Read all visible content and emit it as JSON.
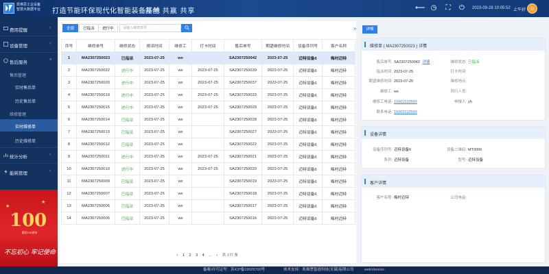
{
  "header": {
    "brand_line1": "凯维思工业设备",
    "brand_line2": "智慧大数据平台",
    "title": "打造节能环保现代化智能装备基地",
    "slogan": "共创 共赢 共享",
    "datetime": "2023-09-28 10:05:52",
    "ampm": "上午好",
    "icons": [
      "back-arrow-icon",
      "clock-icon",
      "fullscreen-icon",
      "power-icon",
      "avatar"
    ]
  },
  "sidebar": {
    "groups": [
      {
        "label": "费用提醒",
        "icon": "money-icon"
      },
      {
        "label": "设备管理",
        "icon": "device-icon"
      },
      {
        "label": "售后服务",
        "icon": "service-icon"
      }
    ],
    "after_sales_title": "售后管理",
    "after_sales_items": [
      "实时售后单",
      "历史售后单"
    ],
    "repair_title": "维修管理",
    "repair_items": [
      "实时维修单",
      "历史维修单"
    ],
    "other_groups": [
      {
        "label": "统计分析",
        "icon": "chart-icon"
      },
      {
        "label": "能耗管理",
        "icon": "energy-icon"
      }
    ],
    "banner_number": "100",
    "banner_sub": "建党100周年",
    "banner_calligraphy": "不忘初心 牢记使命"
  },
  "filter": {
    "tabs": [
      "全部",
      "已指派",
      "进行中"
    ],
    "active_tab": "全部",
    "search_placeholder": "请输入维修单号"
  },
  "table": {
    "headers": [
      "序号",
      "维修单号",
      "维修状态",
      "报派时间",
      "维修工",
      "打卡时间",
      "售后单号",
      "期望维修时间",
      "设备序列号",
      "客户名称"
    ],
    "rows": [
      [
        "1",
        "MA2307250023",
        "已指派",
        "2023-07-25",
        "wx",
        "",
        "SA2307250042",
        "2023-07-25",
        "迈特设备6",
        "梅村迈特"
      ],
      [
        "2",
        "MA2307250022",
        "进行中",
        "2023-07-25",
        "wx",
        "2023-07-25",
        "SA2307250039",
        "2023-07-25",
        "迈特设备6",
        "梅村迈特"
      ],
      [
        "3",
        "MA2307250020",
        "进行中",
        "2023-07-25",
        "wx",
        "2023-07-25",
        "SA2307250037",
        "2023-07-25",
        "迈特设备6",
        "梅村迈特"
      ],
      [
        "4",
        "MA2307250019",
        "进行中",
        "2023-07-25",
        "wx",
        "2023-07-25",
        "SA2307250033",
        "2023-07-25",
        "迈特设备6",
        "梅村迈特"
      ],
      [
        "5",
        "MA2307250015",
        "进行中",
        "2023-07-25",
        "wx",
        "2023-07-25",
        "SA2307250029",
        "2023-07-25",
        "迈特设备6",
        "梅村迈特"
      ],
      [
        "6",
        "MA2307250014",
        "已指派",
        "2023-07-25",
        "wx",
        "",
        "SA2307250028",
        "2023-07-25",
        "迈特设备6",
        "梅村迈特"
      ],
      [
        "7",
        "MA2307250013",
        "已指派",
        "2023-07-25",
        "wx",
        "",
        "SA2307250027",
        "2023-07-25",
        "迈特设备6",
        "梅村迈特"
      ],
      [
        "8",
        "MA2307250012",
        "已指派",
        "2023-07-25",
        "wx",
        "",
        "SA2307250022",
        "2023-07-25",
        "迈特设备6",
        "梅村迈特"
      ],
      [
        "9",
        "MA2307250011",
        "进行中",
        "2023-07-25",
        "wx",
        "2023-07-25",
        "SA2307250021",
        "2023-07-25",
        "迈特设备6",
        "梅村迈特"
      ],
      [
        "10",
        "MA2307250010",
        "进行中",
        "2023-07-25",
        "wx",
        "2023-07-25",
        "SA2307250020",
        "2023-07-25",
        "迈特设备6",
        "梅村迈特"
      ],
      [
        "11",
        "MA2307250009",
        "已指派",
        "2023-07-25",
        "wx",
        "",
        "SA2307250019",
        "2023-07-25",
        "迈特设备6",
        "梅村迈特"
      ],
      [
        "12",
        "MA2307250007",
        "已指派",
        "2023-07-25",
        "wx",
        "",
        "SA2307250018",
        "2023-07-25",
        "迈特设备6",
        "梅村迈特"
      ],
      [
        "13",
        "MA2307250006",
        "已指派",
        "2023-07-25",
        "wx",
        "",
        "SA2307250017",
        "2023-07-25",
        "迈特设备6",
        "梅村迈特"
      ],
      [
        "14",
        "MA2307250005",
        "已指派",
        "2023-07-25",
        "wx",
        "",
        "SA2307250016",
        "2023-07-25",
        "迈特设备6",
        "梅村迈特"
      ]
    ],
    "selected_row": 0
  },
  "pagination": {
    "prev": "‹",
    "pages": [
      "1",
      "2",
      "3",
      "4"
    ],
    "ellipsis": "...",
    "next": "›",
    "total": "共 177 条"
  },
  "detail": {
    "button": "详情",
    "order_title": "维修单 ( MA2307250023 ) 详情",
    "order_fields": {
      "after_sales_no_label": "售后单号:",
      "after_sales_no": "SA2307250042",
      "after_sales_link": "详情",
      "status_label": "维修状态:",
      "status": "已指派",
      "dispatch_time_label": "指派时间:",
      "dispatch_time": "2023-07-25",
      "checkin_label": "打卡时间:",
      "checkin": "",
      "expect_time_label": "期望维修时间:",
      "expect_time": "2023-07-25",
      "location_label": "维修地点:",
      "location": "",
      "worker_label": "维修工:",
      "worker": "wx",
      "companion_label": "同行人员:",
      "companion": "",
      "worker_phone_label": "维修工电话:",
      "worker_phone": "15001510590",
      "reporter_label": "申报人:",
      "reporter": "yh",
      "contact_phone_label": "联系电话:",
      "contact_phone": "15001510590"
    },
    "device_title": "设备详情",
    "device_fields": {
      "serial_label": "设备序列号:",
      "serial": "迈特设备6",
      "qr_label": "设备二维码:",
      "qr": "MT0006",
      "series_label": "系列:",
      "series": "迈特设备",
      "model_label": "型号:",
      "model": "迈特设备"
    },
    "customer_title": "客户详情",
    "customer_fields": {
      "name_label": "客户名称:",
      "name": "梅村迈特",
      "phone_label": "公司电话:",
      "phone": ""
    }
  },
  "footer": {
    "icp": "备案/许可证号：苏ICP备19025700号",
    "support": "技术支持：凯维思智造科技(无锡)有限公司",
    "version": "webVersion:"
  },
  "colors": {
    "accent": "#2f7fe8",
    "header": "#1c4a8e",
    "sidebar": "#14325f",
    "green": "#3cb34a"
  }
}
